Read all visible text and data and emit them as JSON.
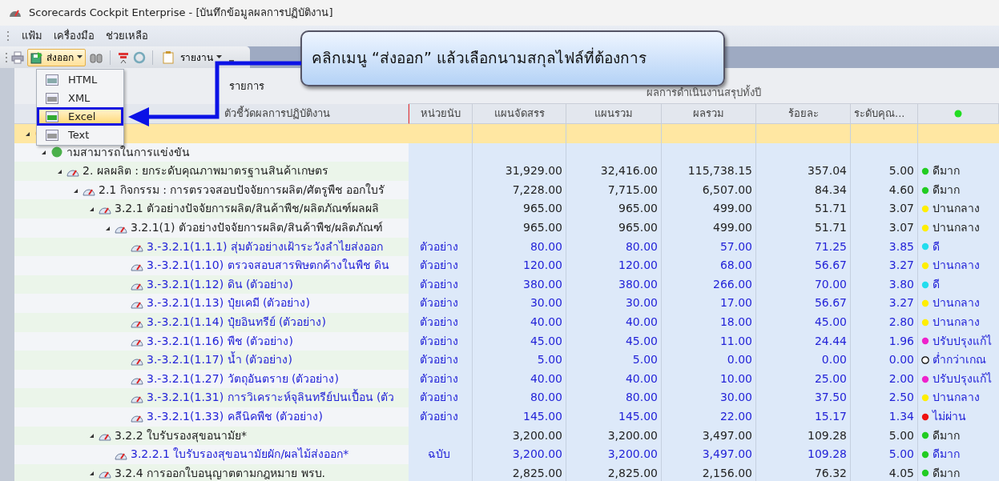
{
  "window": {
    "title": "Scorecards Cockpit Enterprise - [บันทึกข้อมูลผลการปฏิบัติงาน]"
  },
  "menu": [
    "แฟ้ม",
    "เครื่องมือ",
    "ช่วยเหลือ"
  ],
  "toolbar": {
    "export_button": {
      "label": "ส่งออก",
      "expanded": true
    },
    "report_button": {
      "label": "รายงาน"
    }
  },
  "export_menu": {
    "items": [
      {
        "label": "HTML",
        "selected": false
      },
      {
        "label": "XML",
        "selected": false
      },
      {
        "label": "Excel",
        "selected": true
      },
      {
        "label": "Text",
        "selected": false
      }
    ]
  },
  "callout": {
    "text": "คลิกเมนู “ส่งออก” แล้วเลือกนามสกุลไฟล์ที่ต้องการ"
  },
  "grid": {
    "header_left": "รายการ",
    "group_header": "ผลการดำเนินงานสรุปทั้งปี",
    "columns": [
      "ตัวชี้วัดผลการปฏิบัติงาน",
      "หน่วยนับ",
      "แผนจัดสรร",
      "แผนรวม",
      "ผลรวม",
      "ร้อยละ",
      "ระดับคุณ..."
    ],
    "rows": [
      {
        "kind": "perspective",
        "selected": true,
        "expanded": true,
        "children": [
          {
            "kind": "goal",
            "label": "ามสามารถในการแข่งขัน",
            "selected": false,
            "expanded": true,
            "children": [
              {
                "kind": "measure",
                "label": "2. ผลผลิต : ยกระดับคุณภาพมาตรฐานสินค้าเกษตร",
                "allocated": "31,929.00",
                "plan": "32,416.00",
                "result": "115,738.15",
                "percent": "357.04",
                "score": "5.00",
                "status": "ดีมาก",
                "color": "#22cc22",
                "selected": false,
                "expanded": true,
                "children": [
                  {
                    "kind": "measure",
                    "label": "2.1 กิจกรรม : การตรวจสอบปัจจัยการผลิต/ศัตรูพืช ออกใบรั",
                    "allocated": "7,228.00",
                    "plan": "7,715.00",
                    "result": "6,507.00",
                    "percent": "84.34",
                    "score": "4.60",
                    "status": "ดีมาก",
                    "color": "#22cc22",
                    "selected": false,
                    "expanded": true,
                    "children": [
                      {
                        "kind": "measure",
                        "label": "3.2.1 ตัวอย่างปัจจัยการผลิต/สินค้าพืช/ผลิตภัณฑ์ผลผลิ",
                        "allocated": "965.00",
                        "plan": "965.00",
                        "result": "499.00",
                        "percent": "51.71",
                        "score": "3.07",
                        "status": "ปานกลาง",
                        "color": "#ffee00",
                        "selected": false,
                        "expanded": true,
                        "children": [
                          {
                            "kind": "measure",
                            "label": "3.2.1(1) ตัวอย่างปัจจัยการผลิต/สินค้าพืช/ผลิตภัณฑ์",
                            "allocated": "965.00",
                            "plan": "965.00",
                            "result": "499.00",
                            "percent": "51.71",
                            "score": "3.07",
                            "status": "ปานกลาง",
                            "color": "#ffee00",
                            "selected": false,
                            "expanded": true,
                            "children": [
                              {
                                "kind": "measure",
                                "label": "3.-3.2.1(1.1.1) สุ่มตัวอย่างเฝ้าระวังลำไยส่งออก",
                                "unit": "ตัวอย่าง",
                                "allocated": "80.00",
                                "plan": "80.00",
                                "result": "57.00",
                                "percent": "71.25",
                                "score": "3.85",
                                "status": "ดี",
                                "color": "#22ddee",
                                "selected": false
                              },
                              {
                                "kind": "measure",
                                "label": "3.-3.2.1(1.10) ตรวจสอบสารพิษตกค้างในพืช ดิน",
                                "unit": "ตัวอย่าง",
                                "allocated": "120.00",
                                "plan": "120.00",
                                "result": "68.00",
                                "percent": "56.67",
                                "score": "3.27",
                                "status": "ปานกลาง",
                                "color": "#ffee00",
                                "selected": false
                              },
                              {
                                "kind": "measure",
                                "label": "3.-3.2.1(1.12) ดิน (ตัวอย่าง)",
                                "unit": "ตัวอย่าง",
                                "allocated": "380.00",
                                "plan": "380.00",
                                "result": "266.00",
                                "percent": "70.00",
                                "score": "3.80",
                                "status": "ดี",
                                "color": "#22ddee",
                                "selected": false
                              },
                              {
                                "kind": "measure",
                                "label": "3.-3.2.1(1.13) ปุ๋ยเคมี (ตัวอย่าง)",
                                "unit": "ตัวอย่าง",
                                "allocated": "30.00",
                                "plan": "30.00",
                                "result": "17.00",
                                "percent": "56.67",
                                "score": "3.27",
                                "status": "ปานกลาง",
                                "color": "#ffee00",
                                "selected": false
                              },
                              {
                                "kind": "measure",
                                "label": "3.-3.2.1(1.14) ปุ๋ยอินทรีย์ (ตัวอย่าง)",
                                "unit": "ตัวอย่าง",
                                "allocated": "40.00",
                                "plan": "40.00",
                                "result": "18.00",
                                "percent": "45.00",
                                "score": "2.80",
                                "status": "ปานกลาง",
                                "color": "#ffee00",
                                "selected": false
                              },
                              {
                                "kind": "measure",
                                "label": "3.-3.2.1(1.16) พืช (ตัวอย่าง)",
                                "unit": "ตัวอย่าง",
                                "allocated": "45.00",
                                "plan": "45.00",
                                "result": "11.00",
                                "percent": "24.44",
                                "score": "1.96",
                                "status": "ปรับปรุงแก้ไ",
                                "color": "#ee22cc",
                                "selected": false
                              },
                              {
                                "kind": "measure",
                                "label": "3.-3.2.1(1.17) น้ำ (ตัวอย่าง)",
                                "unit": "ตัวอย่าง",
                                "allocated": "5.00",
                                "plan": "5.00",
                                "result": "0.00",
                                "percent": "0.00",
                                "score": "0.00",
                                "status": "ต่ำกว่าเกณ",
                                "color": "#ffffff",
                                "selected": false
                              },
                              {
                                "kind": "measure",
                                "label": "3.-3.2.1(1.27) วัตถุอันตราย (ตัวอย่าง)",
                                "unit": "ตัวอย่าง",
                                "allocated": "40.00",
                                "plan": "40.00",
                                "result": "10.00",
                                "percent": "25.00",
                                "score": "2.00",
                                "status": "ปรับปรุงแก้ไ",
                                "color": "#ee22cc",
                                "selected": false
                              },
                              {
                                "kind": "measure",
                                "label": "3.-3.2.1(1.31) การวิเคราะห์จุลินทรีย์ปนเปื้อน (ตัว",
                                "unit": "ตัวอย่าง",
                                "allocated": "80.00",
                                "plan": "80.00",
                                "result": "30.00",
                                "percent": "37.50",
                                "score": "2.50",
                                "status": "ปานกลาง",
                                "color": "#ffee00",
                                "selected": false
                              },
                              {
                                "kind": "measure",
                                "label": "3.-3.2.1(1.33) คลีนิคพืช (ตัวอย่าง)",
                                "unit": "ตัวอย่าง",
                                "allocated": "145.00",
                                "plan": "145.00",
                                "result": "22.00",
                                "percent": "15.17",
                                "score": "1.34",
                                "status": "ไม่ผ่าน",
                                "color": "#ee1111",
                                "selected": false
                              }
                            ]
                          }
                        ]
                      },
                      {
                        "kind": "measure",
                        "label": "3.2.2 ใบรับรองสุขอนามัย*",
                        "allocated": "3,200.00",
                        "plan": "3,200.00",
                        "result": "3,497.00",
                        "percent": "109.28",
                        "score": "5.00",
                        "status": "ดีมาก",
                        "color": "#22cc22",
                        "selected": false,
                        "expanded": true,
                        "children": [
                          {
                            "kind": "measure",
                            "label": "3.2.2.1 ใบรับรองสุขอนามัยผัก/ผลไม้ส่งออก*",
                            "unit": "ฉบับ",
                            "allocated": "3,200.00",
                            "plan": "3,200.00",
                            "result": "3,497.00",
                            "percent": "109.28",
                            "score": "5.00",
                            "status": "ดีมาก",
                            "color": "#22cc22",
                            "selected": false
                          }
                        ]
                      },
                      {
                        "kind": "measure",
                        "label": "3.2.4 การออกใบอนุญาตตามกฎหมาย พรบ.",
                        "allocated": "2,825.00",
                        "plan": "2,825.00",
                        "result": "2,156.00",
                        "percent": "76.32",
                        "score": "4.05",
                        "status": "ดีมาก",
                        "color": "#22cc22",
                        "selected": false,
                        "expanded": true
                      }
                    ]
                  }
                ]
              }
            ]
          }
        ]
      }
    ]
  }
}
